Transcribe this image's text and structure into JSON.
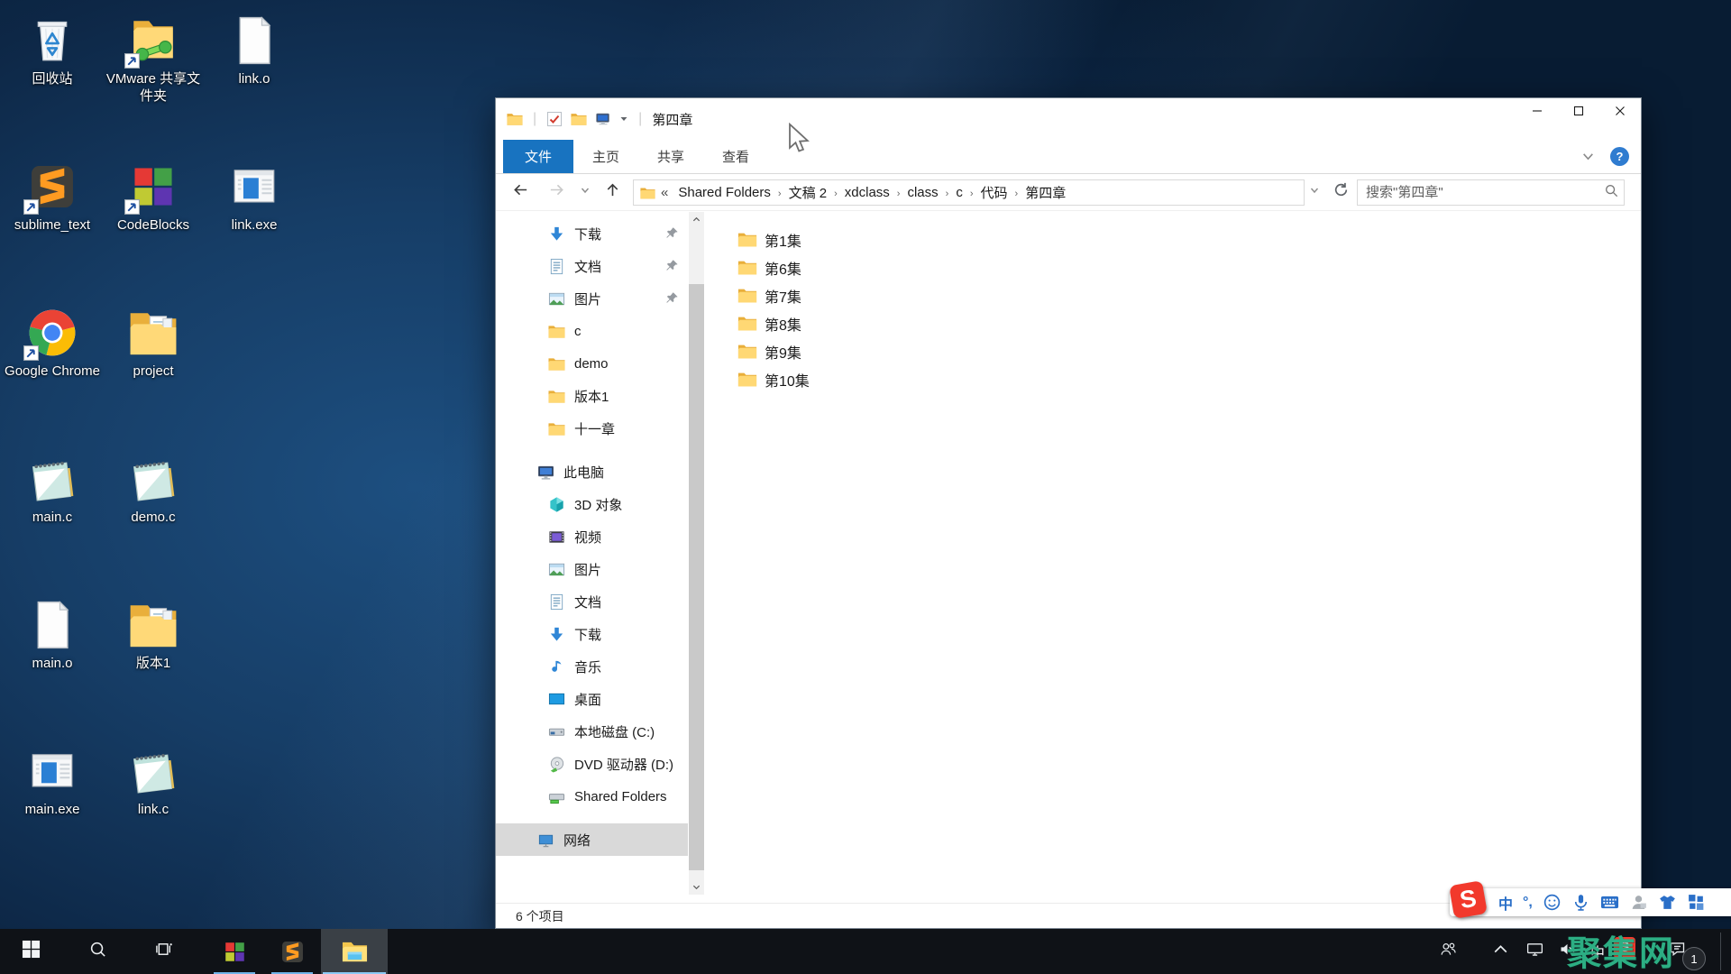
{
  "desktop": {
    "icons": [
      {
        "label": "回收站",
        "icon": "recycle-bin",
        "row": 0,
        "col": 0,
        "shortcut": false
      },
      {
        "label": "VMware 共享文件夹",
        "icon": "vmware-folder",
        "row": 0,
        "col": 1,
        "shortcut": true
      },
      {
        "label": "link.o",
        "icon": "file-blank",
        "row": 0,
        "col": 2,
        "shortcut": false
      },
      {
        "label": "sublime_text",
        "icon": "sublime",
        "row": 1,
        "col": 0,
        "shortcut": true
      },
      {
        "label": "CodeBlocks",
        "icon": "codeblocks",
        "row": 1,
        "col": 1,
        "shortcut": true
      },
      {
        "label": "link.exe",
        "icon": "app-window",
        "row": 1,
        "col": 2,
        "shortcut": false
      },
      {
        "label": "Google Chrome",
        "icon": "chrome",
        "row": 2,
        "col": 0,
        "shortcut": true
      },
      {
        "label": "project",
        "icon": "folder-docs",
        "row": 2,
        "col": 1,
        "shortcut": false
      },
      {
        "label": "main.c",
        "icon": "notepad",
        "row": 3,
        "col": 0,
        "shortcut": false
      },
      {
        "label": "demo.c",
        "icon": "notepad",
        "row": 3,
        "col": 1,
        "shortcut": false
      },
      {
        "label": "main.o",
        "icon": "file-blank",
        "row": 4,
        "col": 0,
        "shortcut": false
      },
      {
        "label": "版本1",
        "icon": "folder-docs",
        "row": 4,
        "col": 1,
        "shortcut": false
      },
      {
        "label": "main.exe",
        "icon": "app-window",
        "row": 5,
        "col": 0,
        "shortcut": false
      },
      {
        "label": "link.c",
        "icon": "notepad",
        "row": 5,
        "col": 1,
        "shortcut": false
      }
    ]
  },
  "explorer": {
    "title": "第四章",
    "help_label": "?",
    "tabs": [
      {
        "label": "文件",
        "active": true
      },
      {
        "label": "主页",
        "active": false
      },
      {
        "label": "共享",
        "active": false
      },
      {
        "label": "查看",
        "active": false
      }
    ],
    "address": {
      "prefix": "«",
      "separator": "›",
      "crumbs": [
        "Shared Folders",
        "文稿 2",
        "xdclass",
        "class",
        "c",
        "代码",
        "第四章"
      ]
    },
    "search_placeholder": "搜索\"第四章\"",
    "nav": [
      {
        "label": "下载",
        "icon": "downloads",
        "indent": 1,
        "pinned": true
      },
      {
        "label": "文档",
        "icon": "documents",
        "indent": 1,
        "pinned": true
      },
      {
        "label": "图片",
        "icon": "pictures",
        "indent": 1,
        "pinned": true
      },
      {
        "label": "c",
        "icon": "folder",
        "indent": 1
      },
      {
        "label": "demo",
        "icon": "folder",
        "indent": 1
      },
      {
        "label": "版本1",
        "icon": "folder",
        "indent": 1
      },
      {
        "label": "十一章",
        "icon": "folder",
        "indent": 1
      },
      {
        "label": "此电脑",
        "icon": "this-pc",
        "indent": 0,
        "gap_before": true
      },
      {
        "label": "3D 对象",
        "icon": "objects-3d",
        "indent": 1
      },
      {
        "label": "视频",
        "icon": "videos",
        "indent": 1
      },
      {
        "label": "图片",
        "icon": "pictures",
        "indent": 1
      },
      {
        "label": "文档",
        "icon": "documents",
        "indent": 1
      },
      {
        "label": "下载",
        "icon": "downloads",
        "indent": 1
      },
      {
        "label": "音乐",
        "icon": "music",
        "indent": 1
      },
      {
        "label": "桌面",
        "icon": "desktop",
        "indent": 1
      },
      {
        "label": "本地磁盘 (C:)",
        "icon": "local-disk",
        "indent": 1
      },
      {
        "label": "DVD 驱动器 (D:)",
        "icon": "dvd-drive",
        "indent": 1
      },
      {
        "label": "Shared Folders",
        "icon": "shared-folders",
        "indent": 1
      },
      {
        "label": "网络",
        "icon": "network",
        "indent": 0,
        "gap_before": true,
        "selected": true
      }
    ],
    "files": [
      {
        "label": "第1集"
      },
      {
        "label": "第6集"
      },
      {
        "label": "第7集"
      },
      {
        "label": "第8集"
      },
      {
        "label": "第9集"
      },
      {
        "label": "第10集"
      }
    ],
    "status": "6 个项目"
  },
  "taskbar": {
    "apps": [
      {
        "name": "codeblocks",
        "icon": "codeblocks",
        "running": true,
        "active": false
      },
      {
        "name": "sublime-text",
        "icon": "sublime",
        "running": true,
        "active": false
      },
      {
        "name": "file-explorer",
        "icon": "file-explorer",
        "running": true,
        "active": true
      }
    ],
    "tray_lang": "中",
    "badge": "1"
  },
  "ime": {
    "logo": "S",
    "mode": "中",
    "punct": "°,"
  },
  "watermark": "聚集网"
}
